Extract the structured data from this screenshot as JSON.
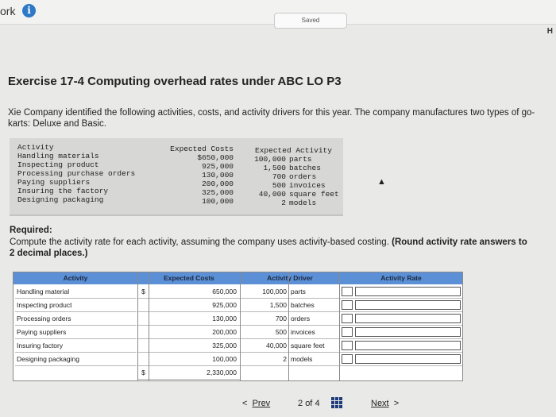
{
  "header": {
    "work_label": "ork",
    "info_glyph": "i",
    "saved_label": "Saved",
    "corner_letter": "H"
  },
  "exercise": {
    "title": "Exercise 17-4 Computing overhead rates under ABC LO P3",
    "intro": "Xie Company identified the following activities, costs, and activity drivers for this year. The company manufactures two types of go-karts: Deluxe and Basic."
  },
  "given": {
    "col_activity": "Activity",
    "col_costs": "Expected Costs",
    "col_expected": "Expected Activity",
    "rows": [
      {
        "activity": "Handling materials",
        "cost": "$650,000",
        "qty": "100,000",
        "unit": "parts"
      },
      {
        "activity": "Inspecting product",
        "cost": "925,000",
        "qty": "1,500",
        "unit": "batches"
      },
      {
        "activity": "Processing purchase orders",
        "cost": "130,000",
        "qty": "700",
        "unit": "orders"
      },
      {
        "activity": "Paying suppliers",
        "cost": "200,000",
        "qty": "500",
        "unit": "invoices"
      },
      {
        "activity": "Insuring the factory",
        "cost": "325,000",
        "qty": "40,000",
        "unit": "square feet"
      },
      {
        "activity": "Designing packaging",
        "cost": "100,000",
        "qty": "2",
        "unit": "models"
      }
    ]
  },
  "required": {
    "label": "Required:",
    "text": "Compute the activity rate for each activity, assuming the company uses activity-based costing.",
    "bold_note": "(Round activity rate answers to 2 decimal places.)"
  },
  "answer_table": {
    "headers": [
      "Activity",
      "Expected Costs",
      "Activity Driver",
      "Activity Rate"
    ],
    "dollar_sign": "$",
    "rows": [
      {
        "activity": "Handling material",
        "cost": "650,000",
        "qty": "100,000",
        "unit": "parts",
        "dollar": true
      },
      {
        "activity": "Inspecting product",
        "cost": "925,000",
        "qty": "1,500",
        "unit": "batches",
        "dollar": false
      },
      {
        "activity": "Processing orders",
        "cost": "130,000",
        "qty": "700",
        "unit": "orders",
        "dollar": false
      },
      {
        "activity": "Paying suppliers",
        "cost": "200,000",
        "qty": "500",
        "unit": "invoices",
        "dollar": false
      },
      {
        "activity": "Insuring factory",
        "cost": "325,000",
        "qty": "40,000",
        "unit": "square feet",
        "dollar": false
      },
      {
        "activity": "Designing packaging",
        "cost": "100,000",
        "qty": "2",
        "unit": "models",
        "dollar": false
      }
    ],
    "total": "2,330,000"
  },
  "navigation": {
    "prev_arrow": "<",
    "prev_label": "Prev",
    "page_current": "2",
    "page_of": "of",
    "page_total": "4",
    "next_label": "Next",
    "next_arrow": ">"
  }
}
